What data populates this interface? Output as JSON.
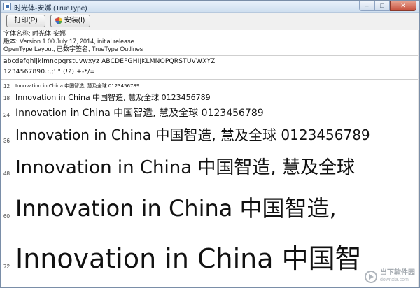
{
  "window": {
    "title": "时光体-安娜 (TrueType)",
    "controls": {
      "minimize": "–",
      "maximize": "□",
      "close": "✕"
    }
  },
  "toolbar": {
    "print_label": "打印(P)",
    "install_label": "安装(I)"
  },
  "info": {
    "font_name": "字体名称: 时光体-安娜",
    "version": "版本: Version 1.00 July 17, 2014, initial release",
    "features": "OpenType Layout, 已数字签名, TrueType Outlines"
  },
  "charset": {
    "line1": "abcdefghijklmnopqrstuvwxyz  ABCDEFGHIJKLMNOPQRSTUVWXYZ",
    "line2": "1234567890.:,;' \" (!?) +-*/="
  },
  "samples": [
    {
      "size": "12",
      "text": "Innovation in China  中国智造,  慧及全球  0123456789"
    },
    {
      "size": "18",
      "text": "Innovation in China  中国智造,  慧及全球  0123456789"
    },
    {
      "size": "24",
      "text": "Innovation in China  中国智造,  慧及全球  0123456789"
    },
    {
      "size": "36",
      "text": "Innovation in China  中国智造,  慧及全球  0123456789"
    },
    {
      "size": "48",
      "text": "Innovation in China  中国智造,  慧及全球"
    },
    {
      "size": "60",
      "text": "Innovation in China  中国智造,"
    },
    {
      "size": "72",
      "text": "Innovation in China  中国智"
    }
  ],
  "watermark": {
    "main": "当下软件园",
    "sub": "downxia.com"
  }
}
